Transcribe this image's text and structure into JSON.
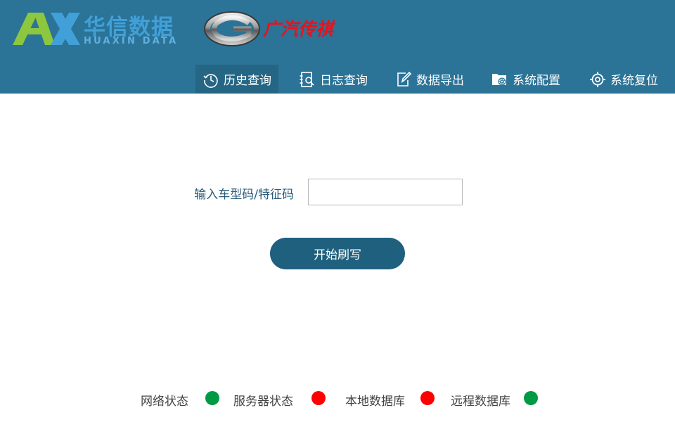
{
  "brand": {
    "name_cn": "华信数据",
    "name_en": "HUAXIN DATA"
  },
  "partner": {
    "name_cn": "广汽传祺"
  },
  "nav": {
    "items": [
      {
        "label": "历史查询",
        "icon": "history-icon",
        "active": true
      },
      {
        "label": "日志查询",
        "icon": "log-search-icon",
        "active": false
      },
      {
        "label": "数据导出",
        "icon": "export-icon",
        "active": false
      },
      {
        "label": "系统配置",
        "icon": "folder-gear-icon",
        "active": false
      },
      {
        "label": "系统复位",
        "icon": "target-reset-icon",
        "active": false
      }
    ]
  },
  "form": {
    "label": "输入车型码/特征码",
    "value": "",
    "placeholder": "",
    "button_label": "开始刷写"
  },
  "status": {
    "items": [
      {
        "label": "网络状态",
        "state": "ok",
        "color": "#009944"
      },
      {
        "label": "服务器状态",
        "state": "error",
        "color": "#ff0000"
      },
      {
        "label": "本地数据库",
        "state": "error",
        "color": "#ff0000"
      },
      {
        "label": "远程数据库",
        "state": "ok",
        "color": "#009944"
      }
    ]
  },
  "colors": {
    "header_bg": "#2b7397",
    "active_tab_bg": "#256685",
    "button_bg": "#1e607e",
    "brand_blue": "#41a0d8",
    "brand_green": "#8dc63f",
    "partner_red": "#e8121b"
  }
}
